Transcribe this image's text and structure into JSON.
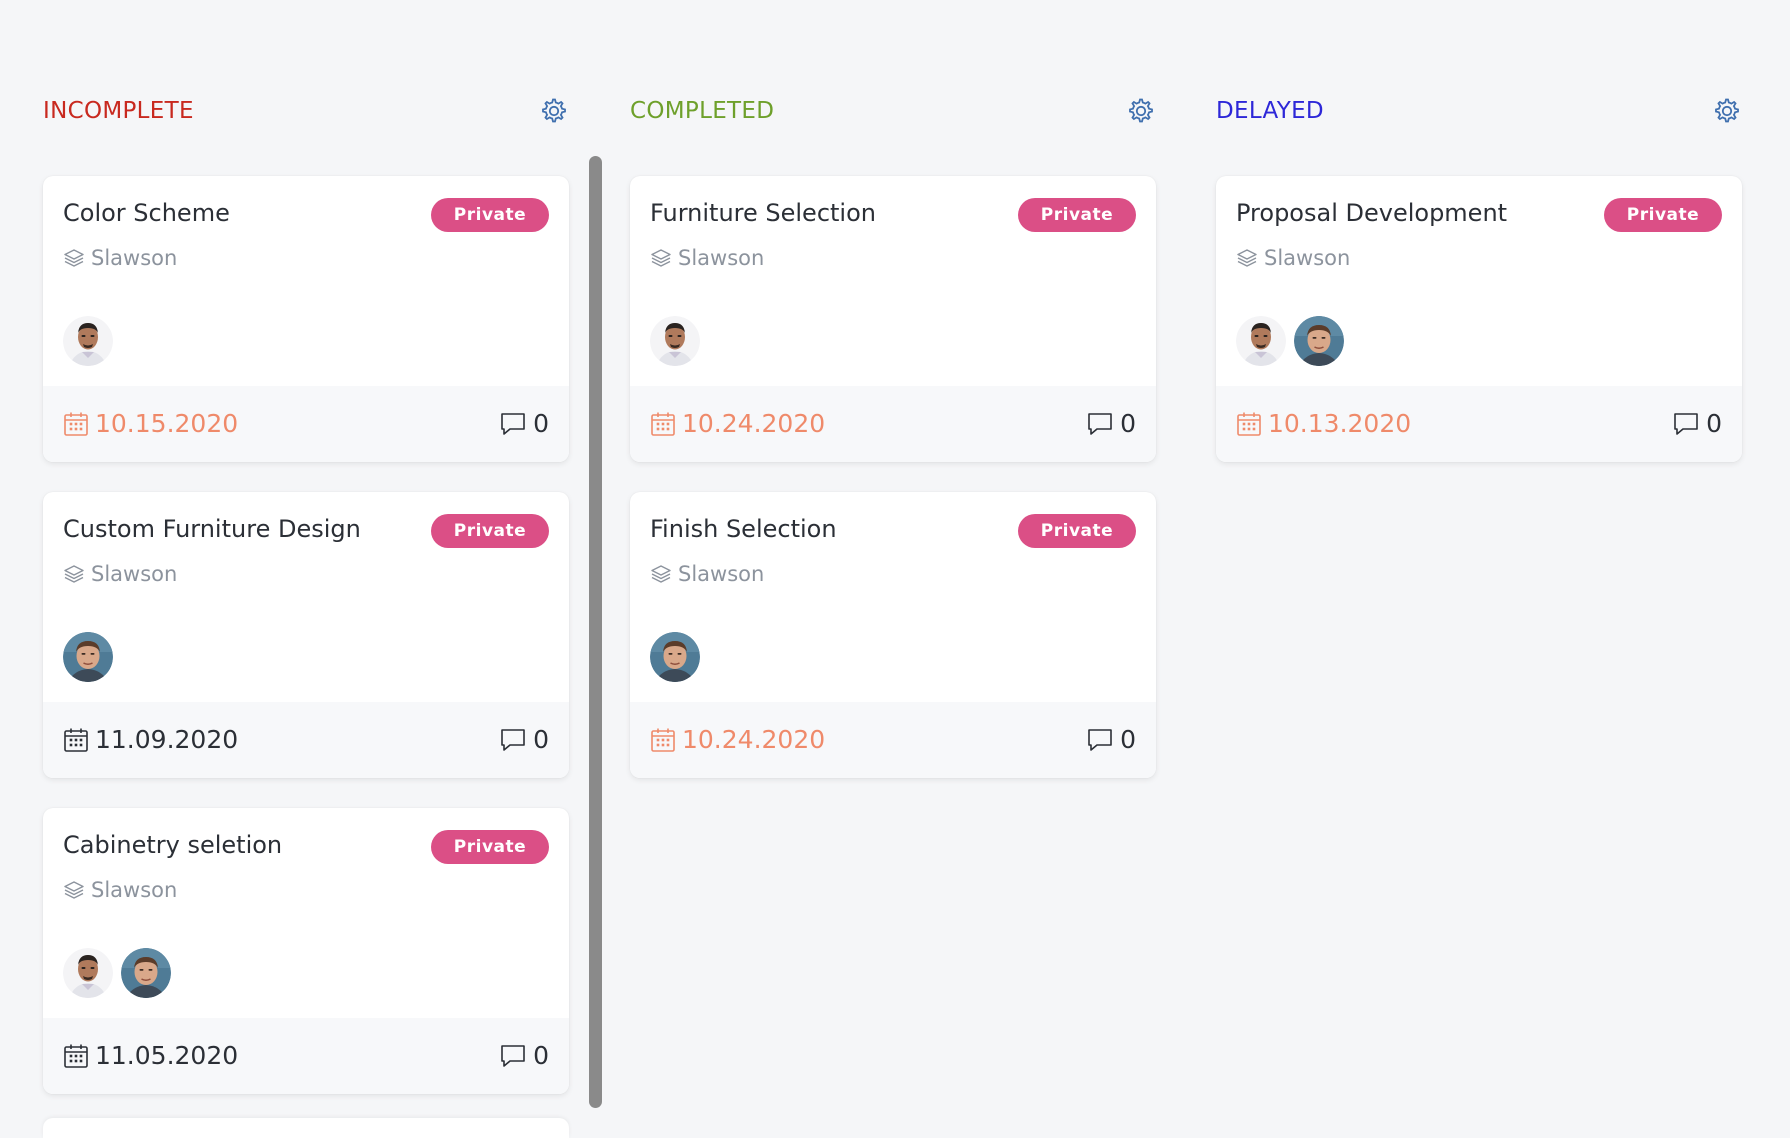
{
  "columns": [
    {
      "title": "INCOMPLETE",
      "color": "#c8291f",
      "cards": [
        {
          "title": "Color Scheme",
          "badge": "Private",
          "project": "Slawson",
          "avatars": [
            "man-bald"
          ],
          "due": "10.15.2020",
          "due_overdue": true,
          "comments": "0"
        },
        {
          "title": "Custom Furniture Design",
          "badge": "Private",
          "project": "Slawson",
          "avatars": [
            "man-young"
          ],
          "due": "11.09.2020",
          "due_overdue": false,
          "comments": "0"
        },
        {
          "title": "Cabinetry seletion",
          "badge": "Private",
          "project": "Slawson",
          "avatars": [
            "man-bald",
            "man-young"
          ],
          "due": "11.05.2020",
          "due_overdue": false,
          "comments": "0"
        }
      ]
    },
    {
      "title": "COMPLETED",
      "color": "#6ea02b",
      "cards": [
        {
          "title": "Furniture Selection",
          "badge": "Private",
          "project": "Slawson",
          "avatars": [
            "man-bald"
          ],
          "due": "10.24.2020",
          "due_overdue": true,
          "comments": "0"
        },
        {
          "title": "Finish Selection",
          "badge": "Private",
          "project": "Slawson",
          "avatars": [
            "man-young"
          ],
          "due": "10.24.2020",
          "due_overdue": true,
          "comments": "0"
        }
      ]
    },
    {
      "title": "DELAYED",
      "color": "#2d27d8",
      "cards": [
        {
          "title": "Proposal Development",
          "badge": "Private",
          "project": "Slawson",
          "avatars": [
            "man-bald",
            "man-young"
          ],
          "due": "10.13.2020",
          "due_overdue": true,
          "comments": "0"
        }
      ]
    }
  ],
  "colors": {
    "badge": "#db4f86",
    "overdue_date": "#ef8a6a",
    "normal_date": "#2b2f36",
    "gear": "#3f6fae"
  },
  "icons": {
    "column_settings": "gear-icon",
    "project": "stack-icon",
    "due_date": "calendar-icon",
    "comments": "comment-icon"
  }
}
